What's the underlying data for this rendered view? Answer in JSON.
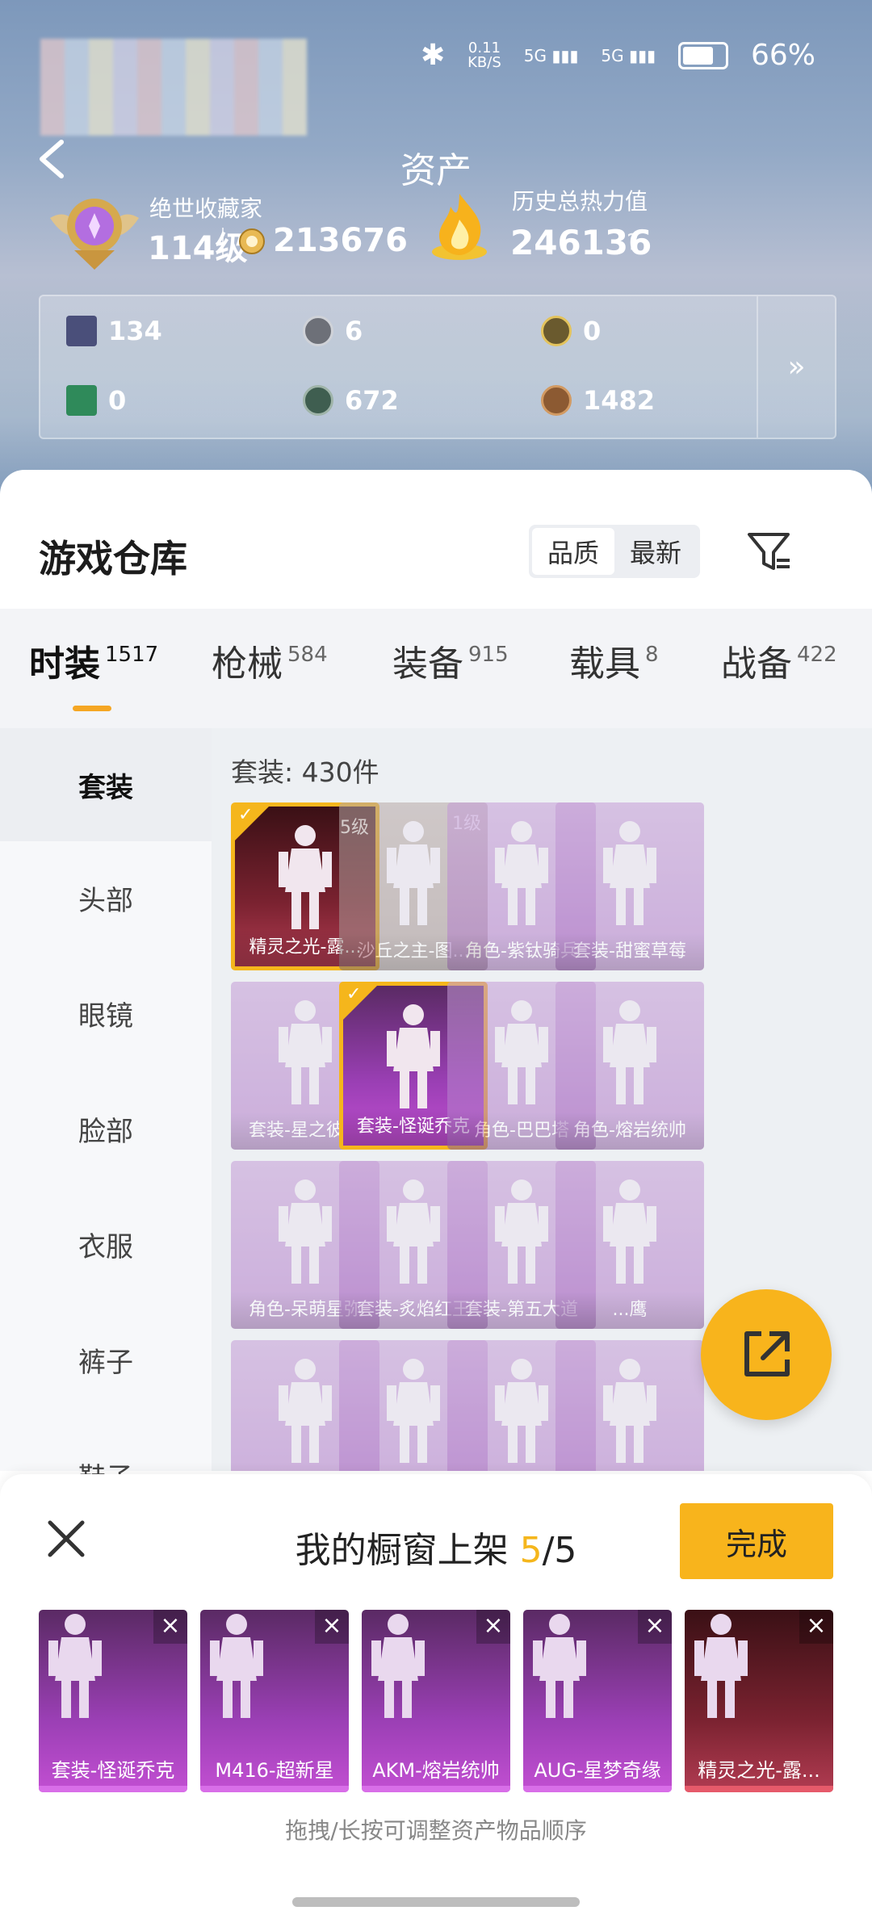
{
  "status": {
    "speed": "0.11",
    "speed_unit": "KB/S",
    "net1": "5G",
    "net2": "5G",
    "battery": "66%",
    "battery_level": 0.66
  },
  "header": {
    "title": "资产",
    "badge_title": "绝世收藏家",
    "level": "114级",
    "coins": "213676",
    "heat_label": "历史总热力值",
    "heat_value": "246136",
    "help": "?"
  },
  "stats": [
    {
      "icon": "card-icon",
      "value": "134"
    },
    {
      "icon": "silver-coin-icon",
      "value": "6"
    },
    {
      "icon": "gold-coin-icon",
      "value": "0"
    },
    {
      "icon": "ticket-icon",
      "value": "0"
    },
    {
      "icon": "medal-icon",
      "value": "672"
    },
    {
      "icon": "bronze-coin-icon",
      "value": "1482"
    }
  ],
  "stats_more": "»",
  "warehouse": {
    "title": "游戏仓库",
    "sort": [
      "品质",
      "最新"
    ]
  },
  "tabs": [
    {
      "label": "时装",
      "count": "1517"
    },
    {
      "label": "枪械",
      "count": "584"
    },
    {
      "label": "装备",
      "count": "915"
    },
    {
      "label": "载具",
      "count": "8"
    },
    {
      "label": "战备",
      "count": "422"
    }
  ],
  "side": [
    "套装",
    "头部",
    "眼镜",
    "脸部",
    "衣服",
    "裤子",
    "鞋子"
  ],
  "content": {
    "count": "套装: 430件",
    "items": [
      {
        "name": "精灵之光-露...",
        "level": "5级",
        "style": "red",
        "selected": true
      },
      {
        "name": "沙丘之主-图...",
        "level": "1级",
        "style": "tan",
        "selected": false
      },
      {
        "name": "角色-紫钛骑兵",
        "level": "",
        "style": "purple",
        "selected": false
      },
      {
        "name": "套装-甜蜜草莓",
        "level": "",
        "style": "purple",
        "selected": false
      },
      {
        "name": "套装-星之彼岸",
        "level": "",
        "style": "purple",
        "selected": false
      },
      {
        "name": "套装-怪诞乔克",
        "level": "",
        "style": "purple-deep",
        "selected": true
      },
      {
        "name": "角色-巴巴塔",
        "level": "",
        "style": "purple",
        "selected": false
      },
      {
        "name": "角色-熔岩统帅",
        "level": "",
        "style": "purple",
        "selected": false
      },
      {
        "name": "角色-呆萌星弥",
        "level": "",
        "style": "purple",
        "selected": false
      },
      {
        "name": "套装-炙焰红王",
        "level": "",
        "style": "purple",
        "selected": false
      },
      {
        "name": "套装-第五大道",
        "level": "",
        "style": "purple",
        "selected": false
      },
      {
        "name": "...鹰",
        "level": "",
        "style": "purple",
        "selected": false
      },
      {
        "name": "",
        "level": "",
        "style": "purple",
        "selected": false
      },
      {
        "name": "",
        "level": "",
        "style": "purple",
        "selected": false
      },
      {
        "name": "",
        "level": "",
        "style": "purple",
        "selected": false
      },
      {
        "name": "",
        "level": "",
        "style": "purple",
        "selected": false
      }
    ]
  },
  "shelf": {
    "title_prefix": "我的橱窗上架 ",
    "current": "5",
    "total": "/5",
    "done": "完成",
    "slots": [
      {
        "name": "套装-怪诞乔克",
        "style": "purple-deep"
      },
      {
        "name": "M416-超新星",
        "style": "purple-deep"
      },
      {
        "name": "AKM-熔岩统帅",
        "style": "purple-deep"
      },
      {
        "name": "AUG-星梦奇缘",
        "style": "purple-deep"
      },
      {
        "name": "精灵之光-露...",
        "style": "red"
      }
    ],
    "remove": "×",
    "hint": "拖拽/长按可调整资产物品顺序"
  },
  "colors": {
    "accent": "#f8b41c",
    "purple": "#b078c8",
    "red": "#7a2230"
  }
}
